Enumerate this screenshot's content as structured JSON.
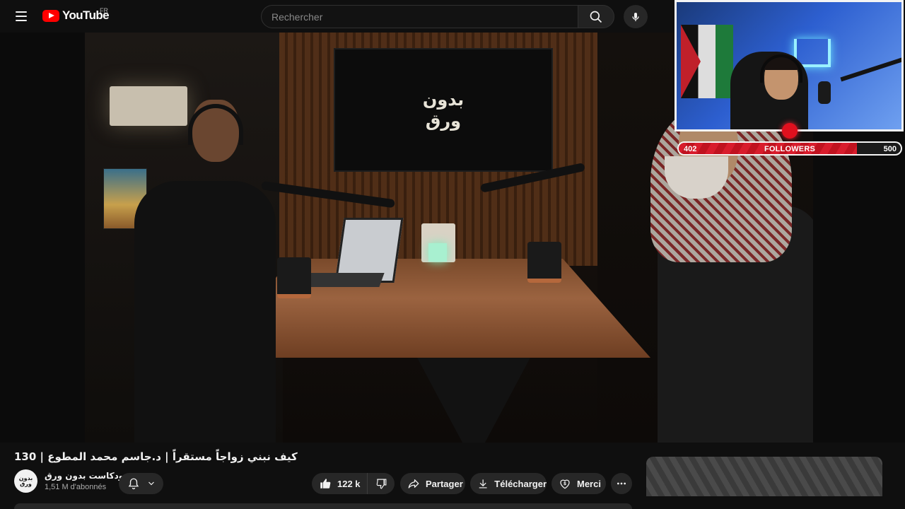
{
  "header": {
    "logo_text": "YouTube",
    "country_code": "FR",
    "search_placeholder": "Rechercher"
  },
  "video": {
    "tv_logo_line1": "بدون",
    "tv_logo_line2": "ورق"
  },
  "stream_overlay": {
    "followers_current": 402,
    "followers_goal": 500,
    "followers_label": "FOLLOWERS",
    "current_text": "402",
    "goal_text": "500",
    "progress_fraction": 0.804
  },
  "watch": {
    "title": "كيف نبني زواجاً مستقراً | د.جاسم محمد المطوع | 130",
    "channel_name": "بودكاست بدون ورق",
    "channel_avatar_text": "بدون ورق",
    "subscribers": "1,51 M d'abonnés",
    "likes": "122 k",
    "share_label": "Partager",
    "download_label": "Télécharger",
    "thanks_label": "Merci"
  },
  "colors": {
    "background": "#0f0f0f",
    "pill": "#272727",
    "youtube_red": "#ff0000",
    "follower_bar_red": "#d81c2c"
  },
  "icons": {
    "menu": "hamburger-icon",
    "search": "search-icon",
    "mic": "mic-icon",
    "bell": "bell-icon",
    "like": "thumbs-up-icon",
    "dislike": "thumbs-down-icon",
    "share": "share-icon",
    "download": "download-icon",
    "thanks": "thanks-icon",
    "more": "more-horizontal-icon"
  }
}
